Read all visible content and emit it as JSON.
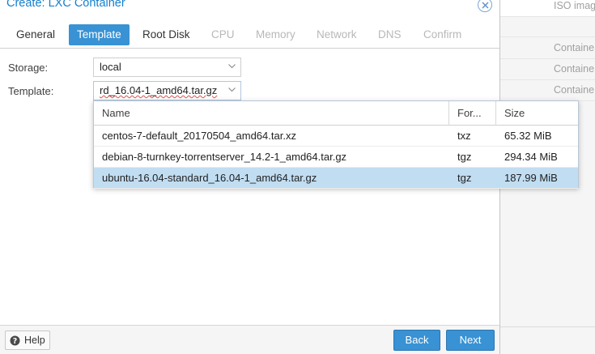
{
  "background": {
    "rows": [
      "ISO imag",
      "Containe",
      "Containe",
      "Containe"
    ]
  },
  "dialog": {
    "title": "Create: LXC Container",
    "tabs": [
      {
        "label": "General",
        "state": "normal"
      },
      {
        "label": "Template",
        "state": "active"
      },
      {
        "label": "Root Disk",
        "state": "normal"
      },
      {
        "label": "CPU",
        "state": "disabled"
      },
      {
        "label": "Memory",
        "state": "disabled"
      },
      {
        "label": "Network",
        "state": "disabled"
      },
      {
        "label": "DNS",
        "state": "disabled"
      },
      {
        "label": "Confirm",
        "state": "disabled"
      }
    ],
    "storage": {
      "label": "Storage:",
      "value": "local"
    },
    "template": {
      "label": "Template:",
      "value": "rd_16.04-1_amd64.tar.gz"
    },
    "grid": {
      "columns": [
        "Name",
        "For...",
        "Size"
      ],
      "rows": [
        {
          "name": "centos-7-default_20170504_amd64.tar.xz",
          "format": "txz",
          "size": "65.32 MiB",
          "selected": false
        },
        {
          "name": "debian-8-turnkey-torrentserver_14.2-1_amd64.tar.gz",
          "format": "tgz",
          "size": "294.34 MiB",
          "selected": false
        },
        {
          "name": "ubuntu-16.04-standard_16.04-1_amd64.tar.gz",
          "format": "tgz",
          "size": "187.99 MiB",
          "selected": true
        }
      ]
    },
    "footer": {
      "help": "Help",
      "back": "Back",
      "next": "Next"
    }
  },
  "colors": {
    "accent": "#3892d4",
    "selected_row": "#c1ddf1",
    "title": "#157fcc"
  }
}
